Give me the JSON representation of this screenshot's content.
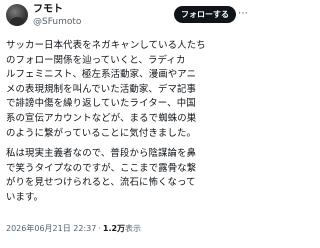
{
  "author": {
    "display_name": "フモト",
    "handle": "@SFumoto"
  },
  "follow_label": "フォローする",
  "more_icon": "more-horizontal-icon",
  "text": {
    "para1": "サッカー日本代表をネガキャンしている人たち\nのフォロー関係を辿っていくと、ラディカ\nルフェミニスト、極左系活動家、漫画やアニ\nメの表現規制を叫んでいた活動家、デマ記事\nで誹謗中傷を繰り返していたライター、中国\n系の宣伝アカウントなどが、まるで蜘蛛の巣\nのように繋がっていることに気付きました。",
    "para2": "私は現実主義者なので、普段から陰謀論を鼻\nで笑うタイプなのですが、ここまで露骨な繋\nがりを見せつけられると、流石に怖くなって\nいます。"
  },
  "meta": {
    "timestamp": "2026年06月21日 22:37",
    "separator": "·",
    "views_count": "1.2万",
    "views_label": "表示"
  }
}
